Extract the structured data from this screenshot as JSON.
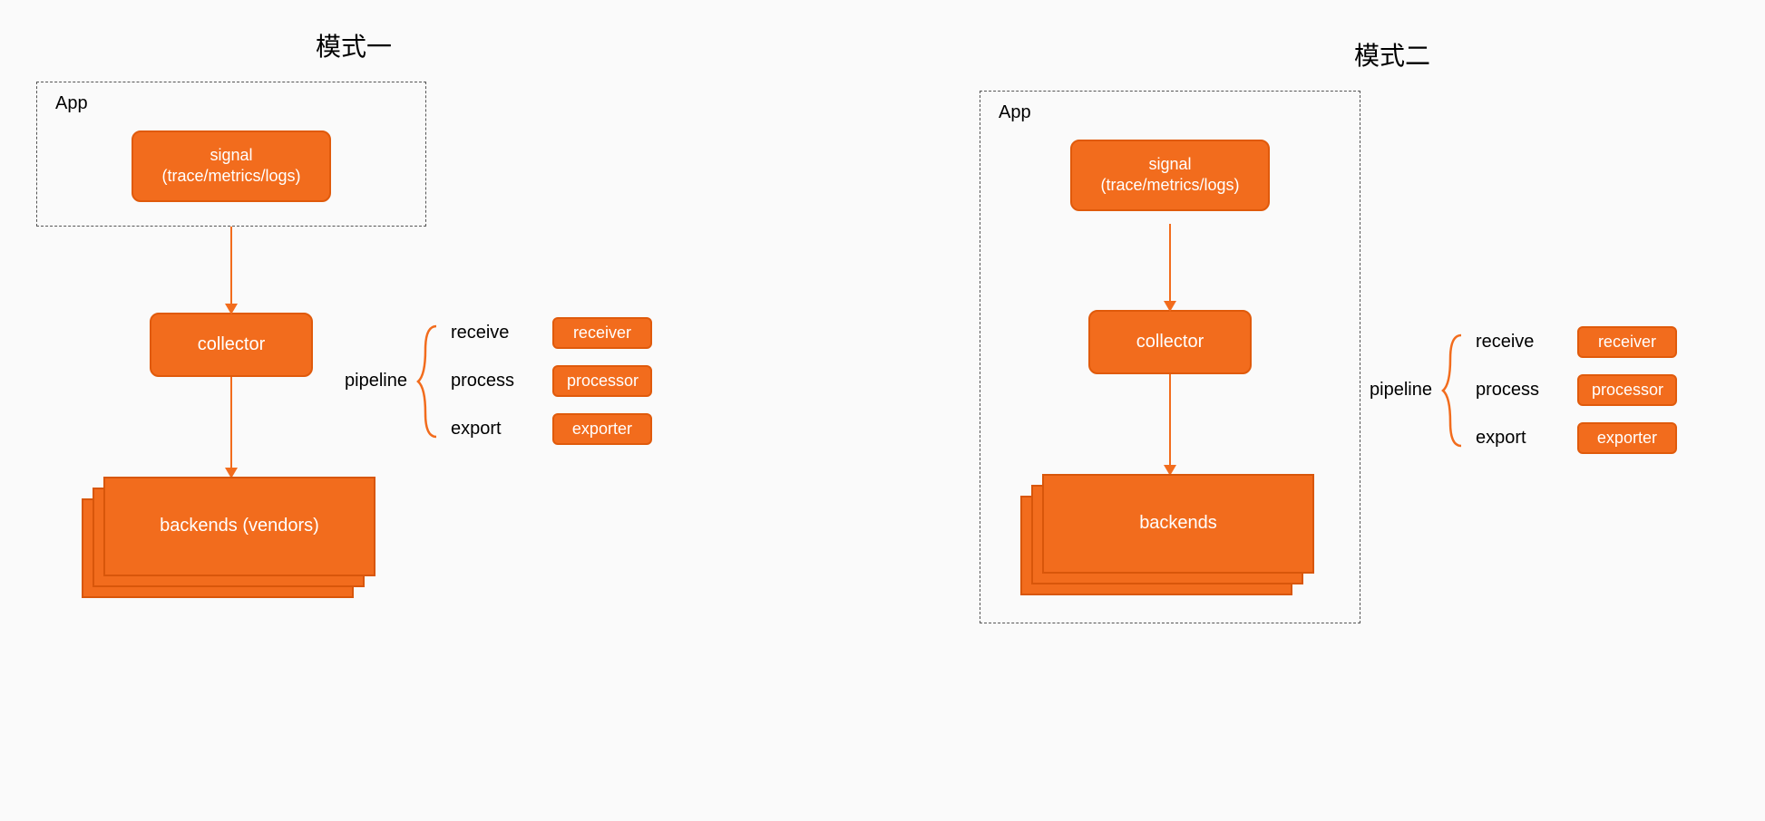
{
  "colors": {
    "accent": "#f26c1d",
    "accent_border": "#e05a0b",
    "dash": "#555"
  },
  "mode1": {
    "title": "模式一",
    "app_label": "App",
    "signal_line1": "signal",
    "signal_line2": "(trace/metrics/logs)",
    "collector": "collector",
    "backends": "backends (vendors)",
    "pipeline_label": "pipeline",
    "stages": [
      {
        "verb": "receive",
        "noun": "receiver"
      },
      {
        "verb": "process",
        "noun": "processor"
      },
      {
        "verb": "export",
        "noun": "exporter"
      }
    ]
  },
  "mode2": {
    "title": "模式二",
    "app_label": "App",
    "signal_line1": "signal",
    "signal_line2": "(trace/metrics/logs)",
    "collector": "collector",
    "backends": "backends",
    "pipeline_label": "pipeline",
    "stages": [
      {
        "verb": "receive",
        "noun": "receiver"
      },
      {
        "verb": "process",
        "noun": "processor"
      },
      {
        "verb": "export",
        "noun": "exporter"
      }
    ]
  }
}
